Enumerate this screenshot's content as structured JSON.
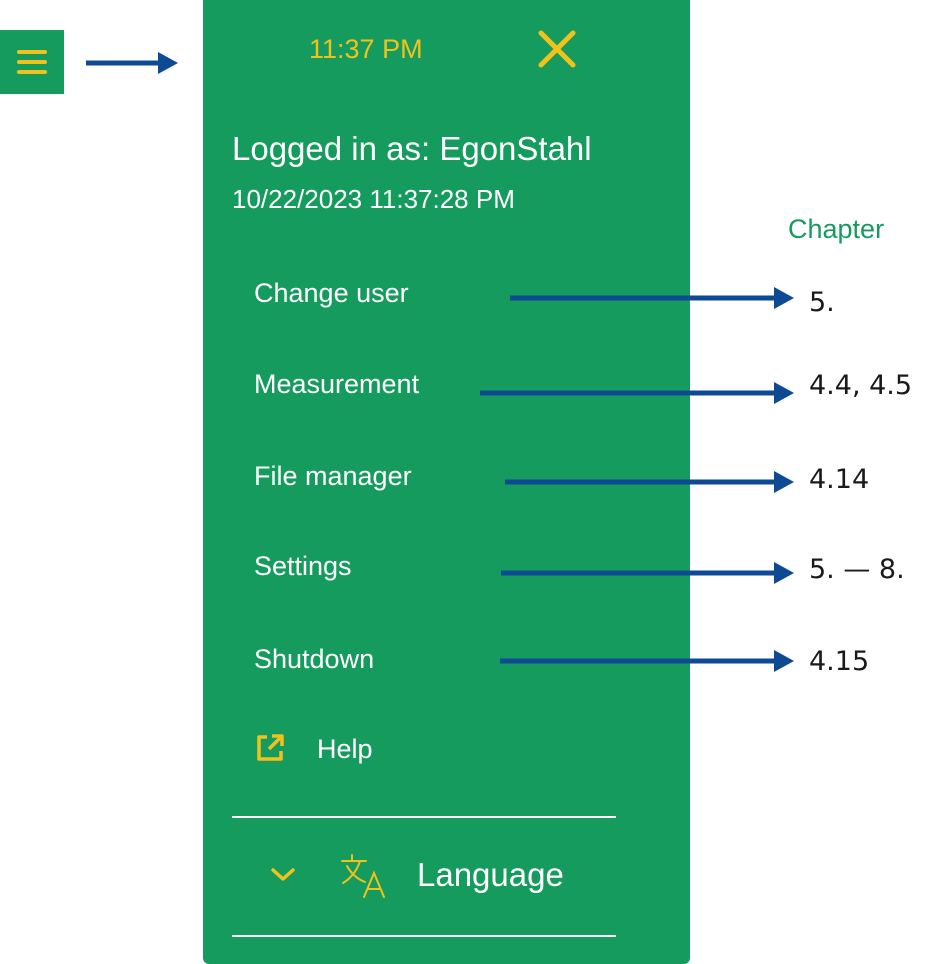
{
  "colors": {
    "panel": "#169b5e",
    "accent": "#f2c21b",
    "arrow": "#0d4a93",
    "chapter_label": "#169b5e",
    "text_on_panel": "#ffffff"
  },
  "menu_button": {
    "icon": "hamburger-icon"
  },
  "panel": {
    "time": "11:37 PM",
    "close_icon": "close-icon",
    "logged_in": "Logged in as: EgonStahl",
    "datetime": "10/22/2023 11:37:28 PM",
    "items": [
      {
        "label": "Change user"
      },
      {
        "label": "Measurement"
      },
      {
        "label": "File manager"
      },
      {
        "label": "Settings"
      },
      {
        "label": "Shutdown"
      }
    ],
    "help": {
      "label": "Help",
      "icon": "external-link-icon"
    },
    "language": {
      "label": "Language",
      "chevron_icon": "chevron-down-icon",
      "icon": "translate-icon"
    }
  },
  "annotations": {
    "chapter_title": "Chapter",
    "chapters": [
      "5.",
      "4.4, 4.5",
      "4.14",
      "5. — 8.",
      "4.15"
    ]
  }
}
